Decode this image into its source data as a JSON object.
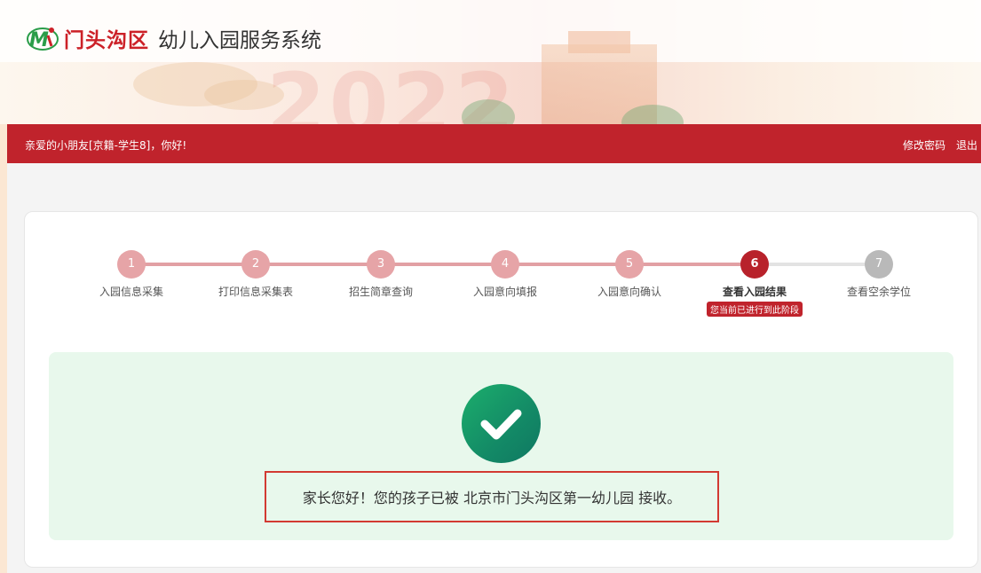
{
  "header": {
    "logo_letters": "M",
    "district": "门头沟区",
    "system_name": "幼儿入园服务系统",
    "banner_year": "2022"
  },
  "userbar": {
    "greeting": "亲爱的小朋友[京籍-学生8]，你好!",
    "change_password": "修改密码",
    "logout": "退出",
    "color": "#c0232c"
  },
  "steps": [
    {
      "number": "1",
      "label": "入园信息采集",
      "state": "done"
    },
    {
      "number": "2",
      "label": "打印信息采集表",
      "state": "done"
    },
    {
      "number": "3",
      "label": "招生简章查询",
      "state": "done"
    },
    {
      "number": "4",
      "label": "入园意向填报",
      "state": "done"
    },
    {
      "number": "5",
      "label": "入园意向确认",
      "state": "done"
    },
    {
      "number": "6",
      "label": "查看入园结果",
      "state": "current",
      "badge": "您当前已进行到此阶段"
    },
    {
      "number": "7",
      "label": "查看空余学位",
      "state": "future"
    }
  ],
  "result": {
    "icon": "check-circle-icon",
    "message": "家长您好！您的孩子已被 北京市门头沟区第一幼儿园 接收。",
    "panel_color": "#e8f8ec",
    "success_color": "#16966a"
  }
}
